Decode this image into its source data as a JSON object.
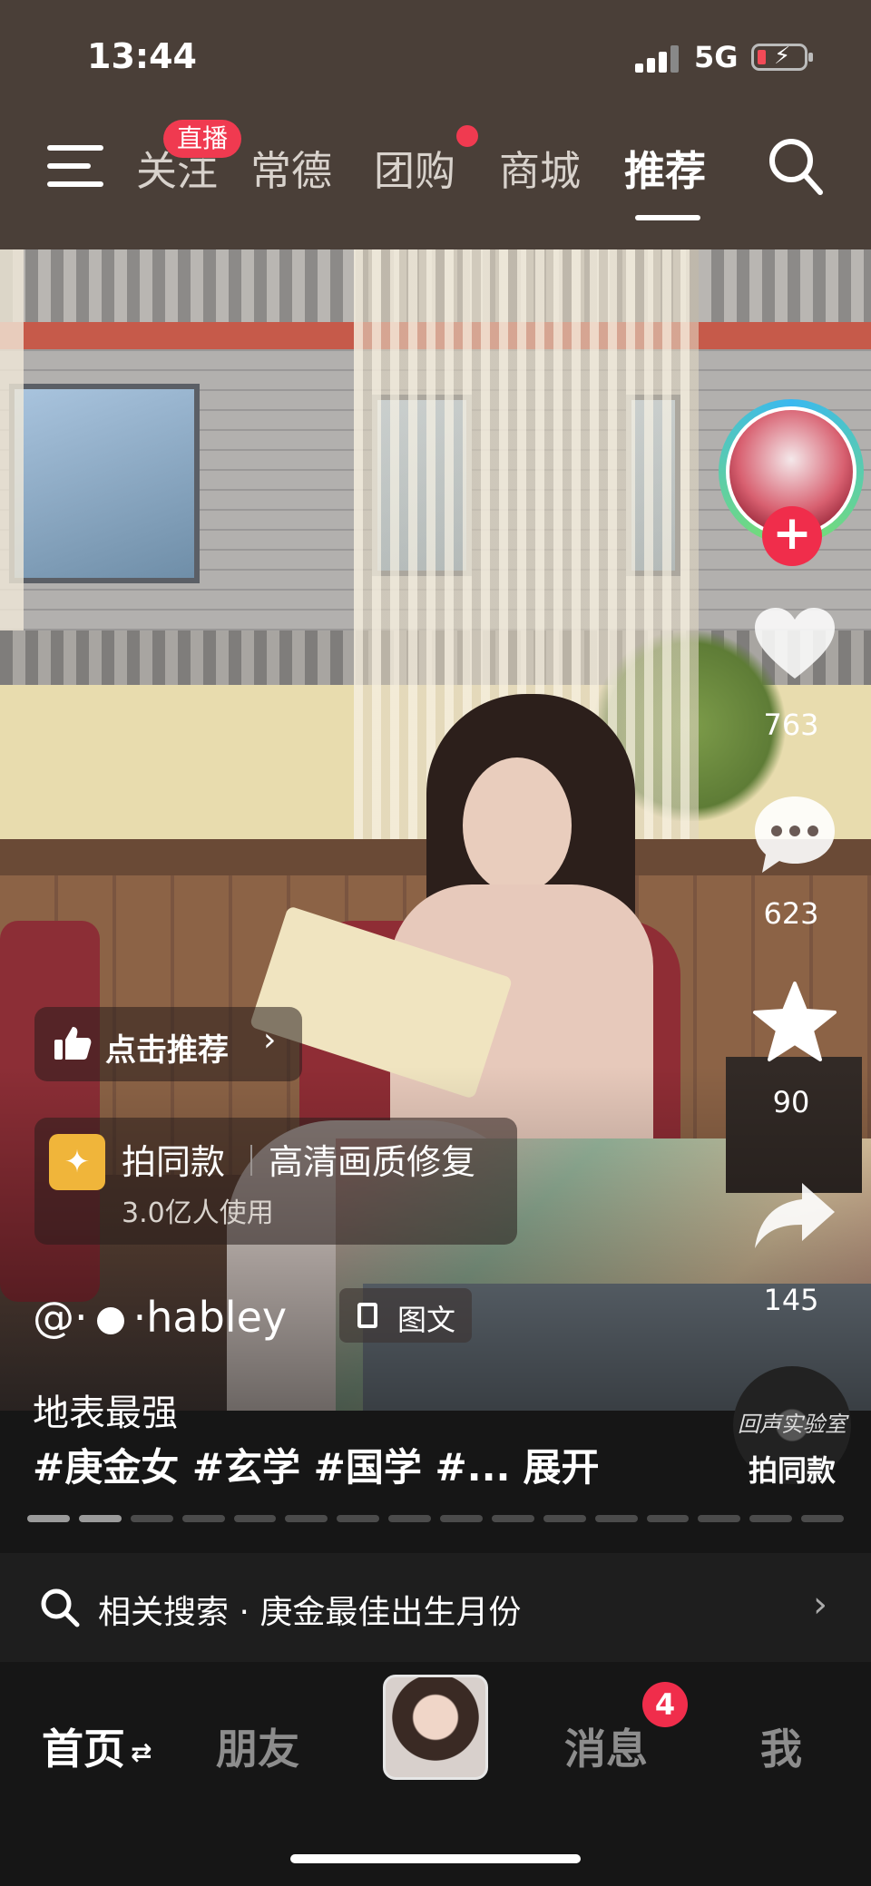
{
  "status_bar": {
    "time": "13:44",
    "network": "5G"
  },
  "top_nav": {
    "tabs": [
      {
        "label": "关注"
      },
      {
        "label": "常德"
      },
      {
        "label": "团购"
      },
      {
        "label": "商城"
      },
      {
        "label": "推荐",
        "active": true
      }
    ],
    "live_badge": "直播"
  },
  "side_actions": {
    "likes": "763",
    "comments": "623",
    "favorites": "90",
    "shares": "145",
    "same_style_label": "拍同款",
    "music_disc_text": "回声实验室"
  },
  "recommend_chip": {
    "label": "点击推荐"
  },
  "template_card": {
    "title": "拍同款",
    "feature": "高清画质修复",
    "users": "3.0亿人使用"
  },
  "post": {
    "author_prefix": "@·",
    "author_name": "·habley",
    "type_label": "图文",
    "caption": "地表最强",
    "hashtags": "#庚金女 #玄学 #国学 #...",
    "expand_label": "展开",
    "progress_total": 16,
    "progress_done": 2
  },
  "related_search": {
    "label": "相关搜索 · 庚金最佳出生月份"
  },
  "bottom_nav": {
    "home": "首页",
    "friends": "朋友",
    "messages": "消息",
    "messages_badge": "4",
    "me": "我"
  },
  "colors": {
    "accent_red": "#f02d4b",
    "topbar_bg": "#4a3f38"
  }
}
